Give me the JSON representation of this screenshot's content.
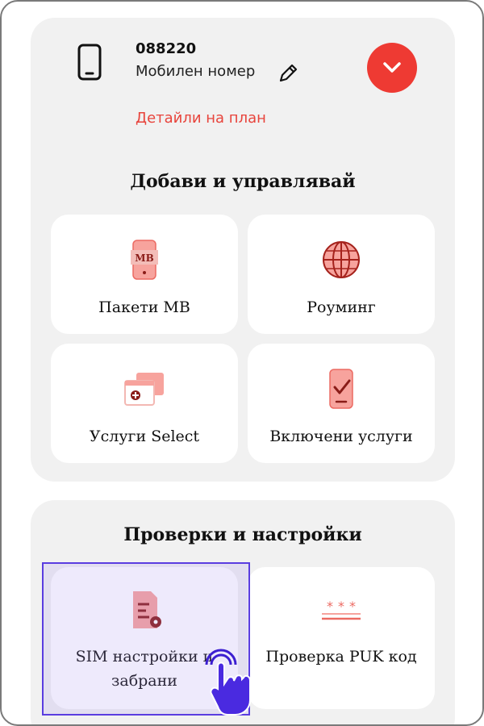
{
  "account": {
    "number": "088220",
    "subtitle": "Мобилен номер",
    "plan_details_link": "Детайли на план"
  },
  "manage_section": {
    "title": "Добави и управлявай",
    "tiles": [
      {
        "label": "Пакети MB",
        "icon": "mb-package-icon"
      },
      {
        "label": "Роуминг",
        "icon": "globe-icon"
      },
      {
        "label": "Услуги Select",
        "icon": "add-service-icon"
      },
      {
        "label": "Включени услуги",
        "icon": "included-services-icon"
      }
    ]
  },
  "checks_section": {
    "title": "Проверки и настройки",
    "tiles": [
      {
        "label": "SIM настройки и забрани",
        "icon": "sim-settings-icon"
      },
      {
        "label": "Проверка PUK код",
        "icon": "puk-code-icon"
      }
    ]
  },
  "colors": {
    "accent": "#ee3a33",
    "link": "#e8443c",
    "card_bg": "#f1f1f1",
    "highlight": "#5a3de0"
  }
}
